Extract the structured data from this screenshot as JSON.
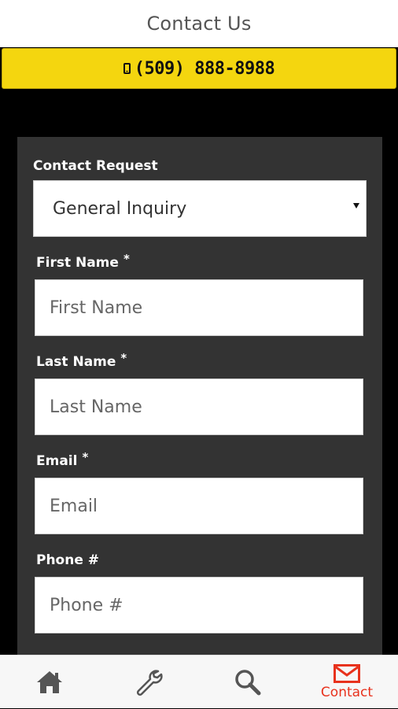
{
  "header": {
    "title": "Contact Us"
  },
  "phone_bar": {
    "icon": "mobile-phone-icon",
    "number": "(509) 888-8988"
  },
  "form": {
    "contact_request": {
      "label": "Contact Request",
      "selected": "General Inquiry"
    },
    "first_name": {
      "label": "First Name",
      "required_mark": "*",
      "placeholder": "First Name",
      "value": ""
    },
    "last_name": {
      "label": "Last Name",
      "required_mark": "*",
      "placeholder": "Last Name",
      "value": ""
    },
    "email": {
      "label": "Email",
      "required_mark": "*",
      "placeholder": "Email",
      "value": ""
    },
    "phone": {
      "label": "Phone #",
      "placeholder": "Phone #",
      "value": ""
    }
  },
  "bottom_nav": {
    "items": [
      {
        "icon": "home-icon",
        "label": ""
      },
      {
        "icon": "wrench-icon",
        "label": ""
      },
      {
        "icon": "search-icon",
        "label": ""
      },
      {
        "icon": "envelope-icon",
        "label": "Contact",
        "active": true
      }
    ]
  },
  "colors": {
    "accent_yellow": "#f4d60f",
    "active_red": "#e8321d",
    "panel_gray": "#333333",
    "background": "#000000"
  }
}
